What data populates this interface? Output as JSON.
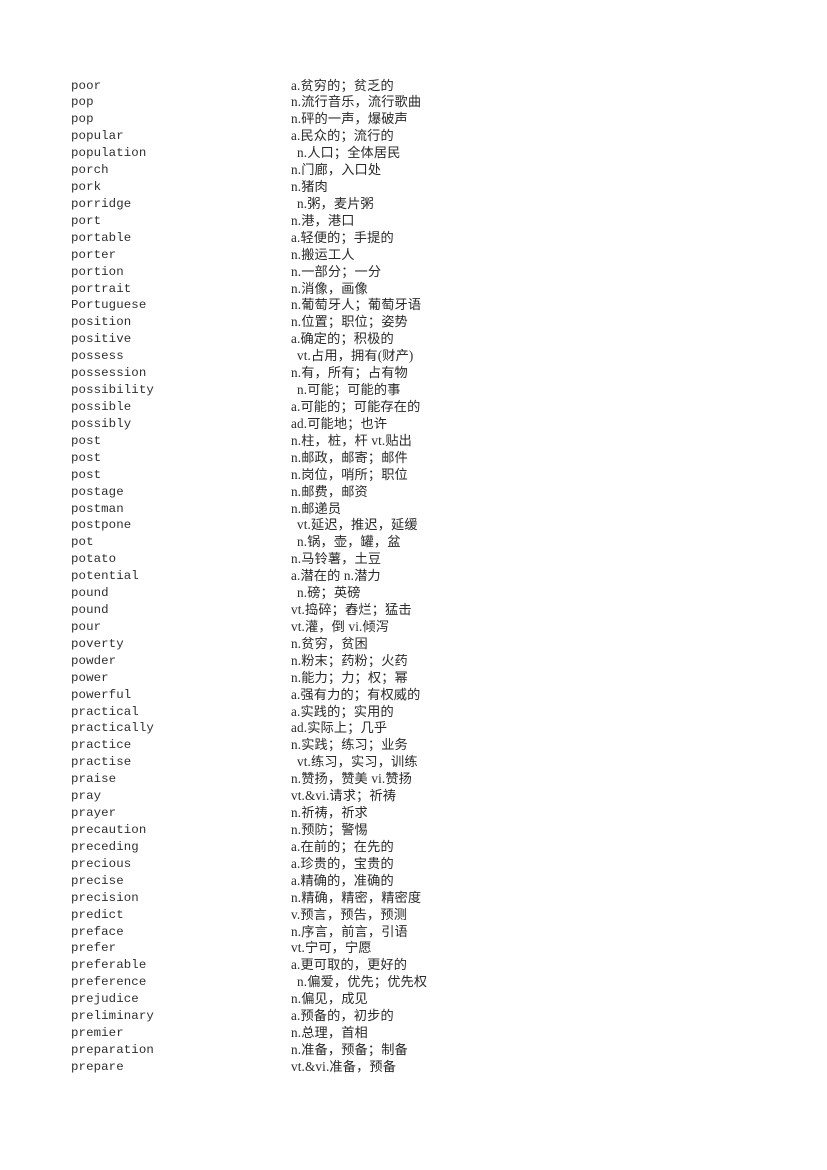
{
  "page": {
    "kind": "vocabulary-word-list",
    "background_color": "#ffffff",
    "text_color": "#2e2e2e",
    "columns": [
      "word",
      "definition"
    ],
    "entry_count": 59
  },
  "entries": [
    {
      "word": "poor",
      "definition": "a.贫穷的；贫乏的",
      "indented": false
    },
    {
      "word": "pop",
      "definition": "n.流行音乐，流行歌曲",
      "indented": false
    },
    {
      "word": "pop",
      "definition": "n.砰的一声，爆破声",
      "indented": false
    },
    {
      "word": "popular",
      "definition": "a.民众的；流行的",
      "indented": false
    },
    {
      "word": "population",
      "definition": "n.人口；全体居民",
      "indented": true
    },
    {
      "word": "porch",
      "definition": "n.门廊，入口处",
      "indented": false
    },
    {
      "word": "pork",
      "definition": "n.猪肉",
      "indented": false
    },
    {
      "word": "porridge",
      "definition": "n.粥，麦片粥",
      "indented": true
    },
    {
      "word": "port",
      "definition": "n.港，港口",
      "indented": false
    },
    {
      "word": "portable",
      "definition": "a.轻便的；手提的",
      "indented": false
    },
    {
      "word": "porter",
      "definition": "n.搬运工人",
      "indented": false
    },
    {
      "word": "portion",
      "definition": "n.一部分；一分",
      "indented": false
    },
    {
      "word": "portrait",
      "definition": "n.消像，画像",
      "indented": false
    },
    {
      "word": "Portuguese",
      "definition": "n.葡萄牙人；葡萄牙语",
      "indented": false
    },
    {
      "word": "position",
      "definition": "n.位置；职位；姿势",
      "indented": false
    },
    {
      "word": "positive",
      "definition": "a.确定的；积极的",
      "indented": false
    },
    {
      "word": "possess",
      "definition": "vt.占用，拥有(财产)",
      "indented": true
    },
    {
      "word": "possession",
      "definition": "n.有，所有；占有物",
      "indented": false
    },
    {
      "word": "possibility",
      "definition": "n.可能；可能的事",
      "indented": true
    },
    {
      "word": "possible",
      "definition": "a.可能的；可能存在的",
      "indented": false
    },
    {
      "word": "possibly",
      "definition": "ad.可能地；也许",
      "indented": false
    },
    {
      "word": "post",
      "definition": "n.柱，桩，杆 vt.贴出",
      "indented": false
    },
    {
      "word": "post",
      "definition": "n.邮政，邮寄；邮件",
      "indented": false
    },
    {
      "word": "post",
      "definition": "n.岗位，哨所；职位",
      "indented": false
    },
    {
      "word": "postage",
      "definition": "n.邮费，邮资",
      "indented": false
    },
    {
      "word": "postman",
      "definition": "n.邮递员",
      "indented": false
    },
    {
      "word": "postpone",
      "definition": "vt.延迟，推迟，延缓",
      "indented": true
    },
    {
      "word": "pot",
      "definition": "n.锅，壶，罐，盆",
      "indented": true
    },
    {
      "word": "potato",
      "definition": "n.马铃薯，土豆",
      "indented": false
    },
    {
      "word": "potential",
      "definition": "a.潜在的 n.潜力",
      "indented": false
    },
    {
      "word": "pound",
      "definition": "n.磅；英磅",
      "indented": true
    },
    {
      "word": "pound",
      "definition": "vt.捣碎；舂烂；猛击",
      "indented": false
    },
    {
      "word": "pour",
      "definition": "vt.灌，倒 vi.倾泻",
      "indented": false
    },
    {
      "word": "poverty",
      "definition": "n.贫穷，贫困",
      "indented": false
    },
    {
      "word": "powder",
      "definition": "n.粉末；药粉；火药",
      "indented": false
    },
    {
      "word": "power",
      "definition": "n.能力；力；权；幂",
      "indented": false
    },
    {
      "word": "powerful",
      "definition": "a.强有力的；有权威的",
      "indented": false
    },
    {
      "word": "practical",
      "definition": "a.实践的；实用的",
      "indented": false
    },
    {
      "word": "practically",
      "definition": "ad.实际上；几乎",
      "indented": false
    },
    {
      "word": "practice",
      "definition": "n.实践；练习；业务",
      "indented": false
    },
    {
      "word": "practise",
      "definition": "vt.练习，实习，训练",
      "indented": true
    },
    {
      "word": "praise",
      "definition": "n.赞扬，赞美 vi.赞扬",
      "indented": false
    },
    {
      "word": "pray",
      "definition": "vt.&vi.请求；祈祷",
      "indented": false
    },
    {
      "word": "prayer",
      "definition": "n.祈祷，祈求",
      "indented": false
    },
    {
      "word": "precaution",
      "definition": "n.预防；警惕",
      "indented": false
    },
    {
      "word": "preceding",
      "definition": "a.在前的；在先的",
      "indented": false
    },
    {
      "word": "precious",
      "definition": "a.珍贵的，宝贵的",
      "indented": false
    },
    {
      "word": "precise",
      "definition": "a.精确的，准确的",
      "indented": false
    },
    {
      "word": "precision",
      "definition": "n.精确，精密，精密度",
      "indented": false
    },
    {
      "word": "predict",
      "definition": "v.预言，预告，预测",
      "indented": false
    },
    {
      "word": "preface",
      "definition": "n.序言，前言，引语",
      "indented": false
    },
    {
      "word": "prefer",
      "definition": "vt.宁可，宁愿",
      "indented": false
    },
    {
      "word": "preferable",
      "definition": "a.更可取的，更好的",
      "indented": false
    },
    {
      "word": "preference",
      "definition": "n.偏爱，优先；优先权",
      "indented": true
    },
    {
      "word": "prejudice",
      "definition": "n.偏见，成见",
      "indented": false
    },
    {
      "word": "preliminary",
      "definition": "a.预备的，初步的",
      "indented": false
    },
    {
      "word": "premier",
      "definition": "n.总理，首相",
      "indented": false
    },
    {
      "word": "preparation",
      "definition": "n.准备，预备；制备",
      "indented": false
    },
    {
      "word": "prepare",
      "definition": "vt.&vi.准备，预备",
      "indented": false
    }
  ]
}
